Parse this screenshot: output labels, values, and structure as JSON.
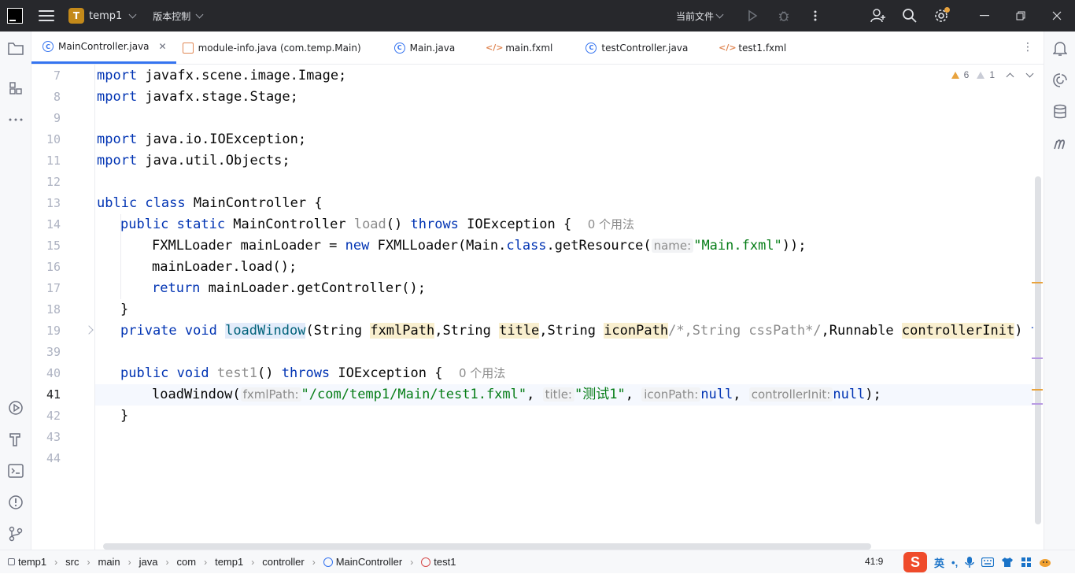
{
  "titlebar": {
    "project_badge": "T",
    "project_name": "temp1",
    "vcs_label": "版本控制",
    "run_config": "当前文件"
  },
  "tabs": [
    {
      "label": "MainController.java",
      "icon": "class-icon",
      "active": true
    },
    {
      "label": "module-info.java (com.temp.Main)",
      "icon": "module-icon",
      "active": false
    },
    {
      "label": "Main.java",
      "icon": "class-icon",
      "active": false
    },
    {
      "label": "main.fxml",
      "icon": "xml-icon",
      "active": false
    },
    {
      "label": "testController.java",
      "icon": "class-icon",
      "active": false
    },
    {
      "label": "test1.fxml",
      "icon": "xml-icon",
      "active": false
    }
  ],
  "inspections": {
    "warnings": "6",
    "weak_warnings": "1"
  },
  "editor": {
    "line_numbers": [
      "7",
      "8",
      "9",
      "10",
      "11",
      "12",
      "13",
      "14",
      "15",
      "16",
      "17",
      "18",
      "19",
      "39",
      "40",
      "41",
      "42",
      "43",
      "44"
    ],
    "current_line": "41",
    "code": {
      "l7_kw": "mport",
      "l7_rest": " javafx.scene.image.Image;",
      "l8_kw": "mport",
      "l8_rest": " javafx.stage.Stage;",
      "l10_kw": "mport",
      "l10_rest": " java.io.IOException;",
      "l11_kw": "mport",
      "l11_rest": " java.util.Objects;",
      "l13_kw": "ublic class",
      "l13_rest": " MainController {",
      "l14_kw": "public static",
      "l14_a": " MainController ",
      "l14_fn": "load",
      "l14_b": "() ",
      "l14_kw2": "throws",
      "l14_c": " IOException {  ",
      "l14_usages": "0 个用法",
      "l15_a": "FXMLLoader mainLoader = ",
      "l15_kw": "new",
      "l15_b": " FXMLLoader(Main.",
      "l15_kw2": "class",
      "l15_c": ".getResource(",
      "l15_hint": "name:",
      "l15_str": "\"Main.fxml\"",
      "l15_d": "));",
      "l16": "mainLoader.load();",
      "l17_kw": "return",
      "l17_rest": " mainLoader.getController();",
      "l18": "}",
      "l19_kw": "private void",
      "l19_sp": " ",
      "l19_fn": "loadWindow",
      "l19_a": "(String ",
      "l19_p1": "fxmlPath",
      "l19_b": ",String ",
      "l19_p2": "title",
      "l19_c": ",String ",
      "l19_p3": "iconPath",
      "l19_cm": "/*,String cssPath*/",
      "l19_d": ",Runnable ",
      "l19_p4": "controllerInit",
      "l19_e": ") ",
      "l19_kw2": "throw",
      "l40_kw": "public void",
      "l40_sp": " ",
      "l40_fn": "test1",
      "l40_a": "() ",
      "l40_kw2": "throws",
      "l40_b": " IOException {  ",
      "l40_usages": "0 个用法",
      "l41_a": "loadWindow(",
      "l41_h1": "fxmlPath:",
      "l41_s1": "\"/com/temp1/Main/test1.fxml\"",
      "l41_b": ", ",
      "l41_h2": "title:",
      "l41_s2": "\"测试1\"",
      "l41_c": ", ",
      "l41_h3": "iconPath:",
      "l41_k1": "null",
      "l41_d": ", ",
      "l41_h4": "controllerInit:",
      "l41_k2": "null",
      "l41_e": ");",
      "l42": "}"
    }
  },
  "statusbar": {
    "breadcrumbs": [
      "temp1",
      "src",
      "main",
      "java",
      "com",
      "temp1",
      "controller",
      "MainController",
      "test1"
    ],
    "position": "41:9",
    "ime_logo": "S",
    "ime_lang": "英"
  },
  "colors": {
    "accent": "#3574f0",
    "keyword": "#0033b3",
    "string": "#067d17",
    "warning": "#e8a33e"
  }
}
